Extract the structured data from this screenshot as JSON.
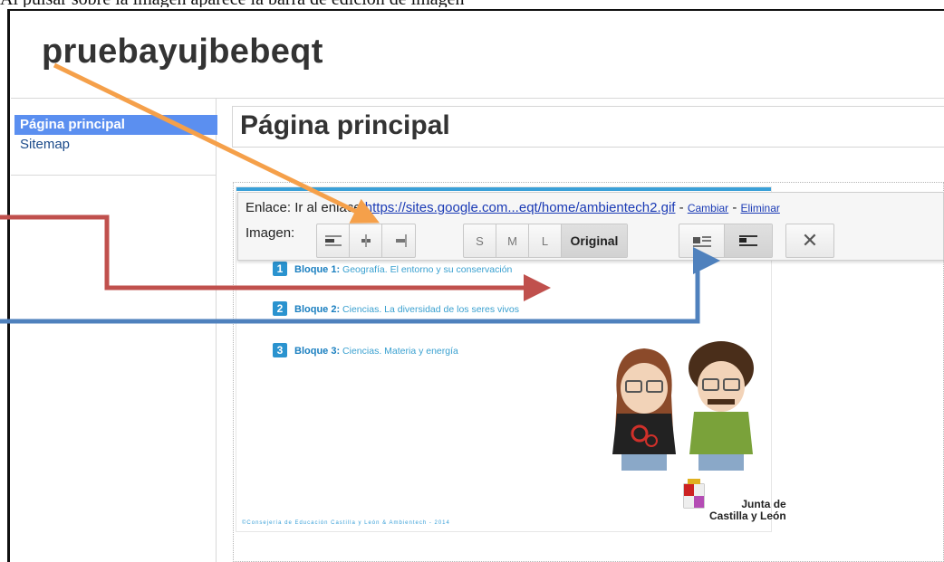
{
  "caption": "Al pulsar sobre la imagen aparece la barra de edición de imagen",
  "site": {
    "title": "pruebayujbebeqt"
  },
  "sidebar": {
    "items": [
      {
        "label": "Página principal"
      },
      {
        "label": "Sitemap"
      }
    ]
  },
  "page": {
    "title": "Página principal"
  },
  "toolbar": {
    "link_label": "Enlace:",
    "goto_label": "Ir al enlace:",
    "url": "https://sites.google.com...eqt/home/ambientech2.gif",
    "sep1": " - ",
    "change_label": "Cambiar",
    "sep2": " - ",
    "remove_label": "Eliminar",
    "image_label": "Imagen:",
    "size_s": "S",
    "size_m": "M",
    "size_l": "L",
    "size_original": "Original",
    "close_symbol": "✕"
  },
  "embedded": {
    "bloque1": {
      "num": "1",
      "name": "Bloque 1:",
      "desc": "Geografía. El entorno y su conservación"
    },
    "bloque2": {
      "num": "2",
      "name": "Bloque 2:",
      "desc": "Ciencias. La diversidad de los seres vivos"
    },
    "bloque3": {
      "num": "3",
      "name": "Bloque 3:",
      "desc": "Ciencias. Materia y energía"
    },
    "credit": "©Consejería de Educación Castilla y León & Ambientech - 2014",
    "logo_line1": "Junta de",
    "logo_line2": "Castilla y León"
  },
  "colors": {
    "arrow_orange": "#f5a04a",
    "arrow_red": "#c0504d",
    "arrow_blue": "#4f81bd"
  },
  "icons": [
    "align-left-icon",
    "align-center-icon",
    "align-right-icon",
    "wrap-text-icon",
    "no-wrap-icon",
    "close-icon"
  ]
}
